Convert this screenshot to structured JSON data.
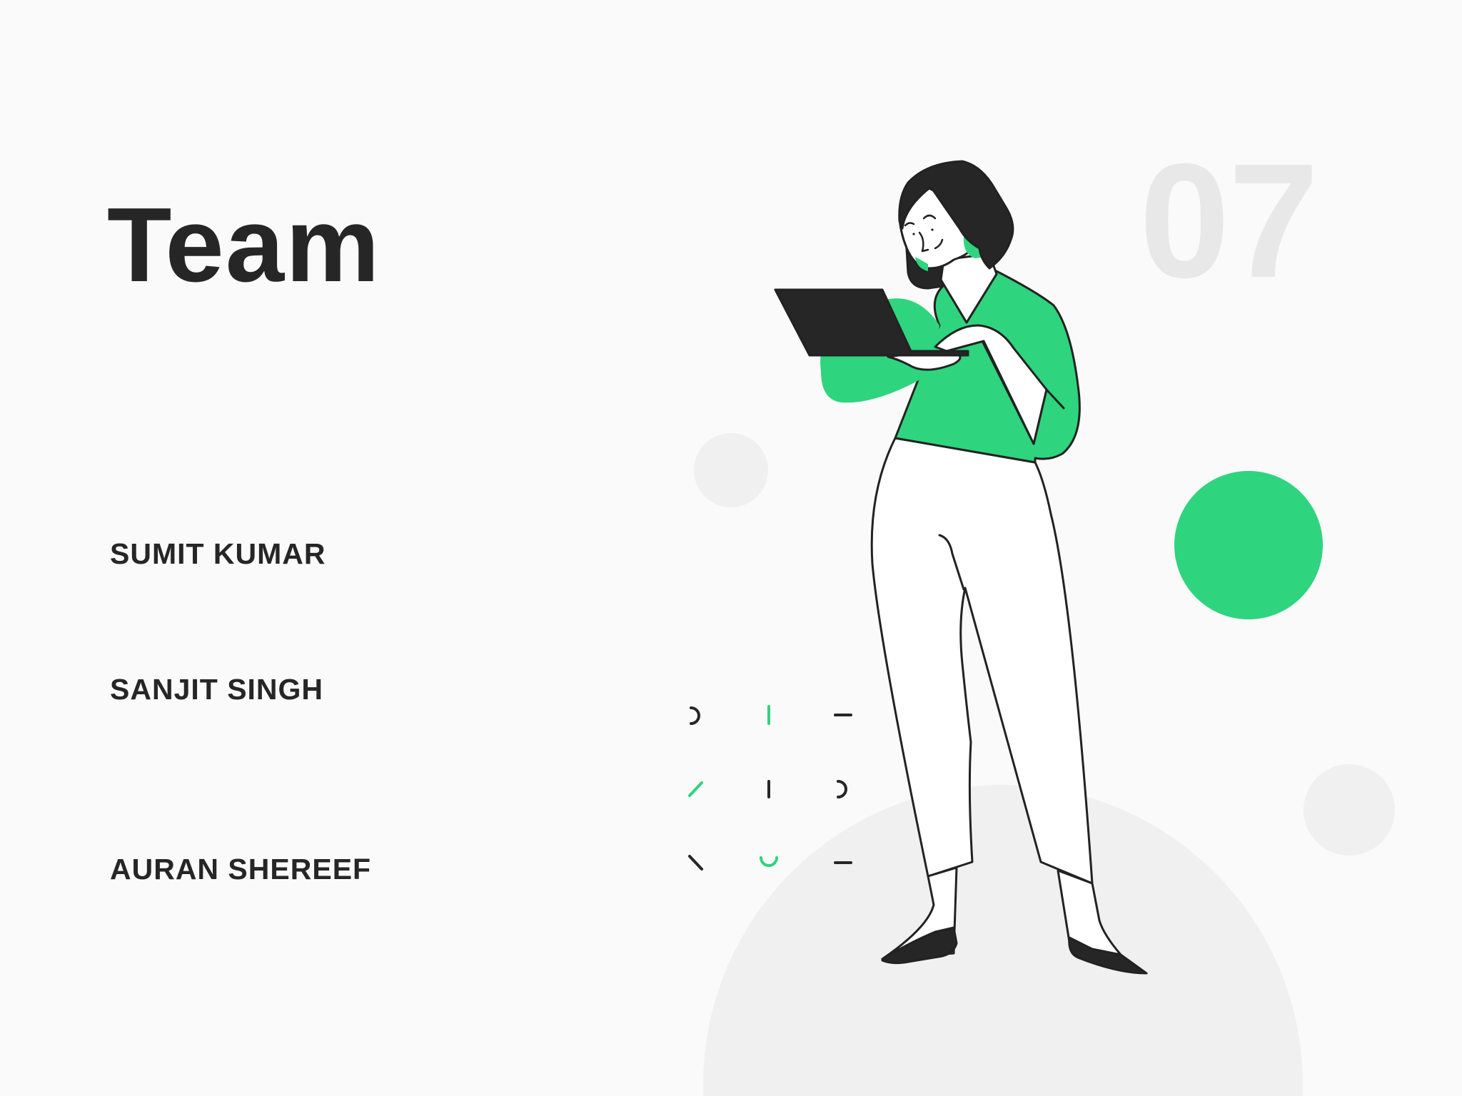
{
  "slide": {
    "title": "Team",
    "number": "07"
  },
  "members": [
    {
      "name": "SUMIT KUMAR"
    },
    {
      "name": "SANJIT SINGH"
    },
    {
      "name": "AURAN SHEREEF"
    }
  ],
  "illustration": {
    "icon": "woman-with-laptop-illustration"
  },
  "colors": {
    "background": "#FAFAFA",
    "text": "#262626",
    "accent": "#2FD47E",
    "number": "#E8E8E8",
    "decor_gray": "#EFEFEF",
    "outline": "#222222"
  }
}
